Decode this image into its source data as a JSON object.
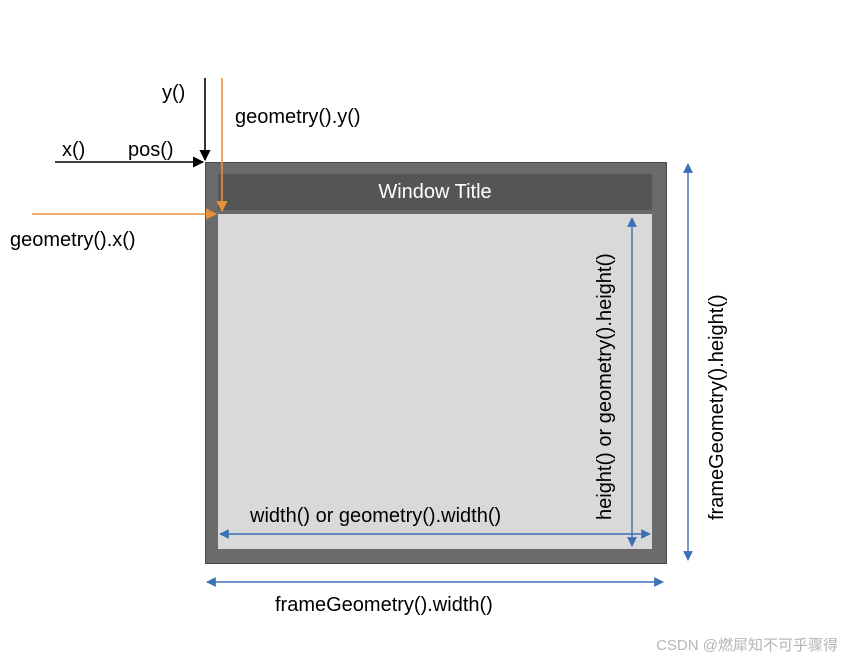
{
  "labels": {
    "y": "y()",
    "x": "x()",
    "pos": "pos()",
    "gy": "geometry().y()",
    "gx": "geometry().x()",
    "width": "width() or geometry().width()",
    "height": "height() or geometry().height()",
    "frameWidth": "frameGeometry().width()",
    "frameHeight": "frameGeometry().height()"
  },
  "window": {
    "title": "Window Title"
  },
  "watermark": "CSDN @燃犀知不可乎骤得",
  "colors": {
    "frame": "#6b6b6b",
    "titlebar": "#555555",
    "client": "#d9d9d9",
    "blackArrow": "#000000",
    "orangeArrow": "#e8913c",
    "blueArrow": "#3b6fb6"
  },
  "geometry_note": "Diagram of Qt widget geometry: x()/y()/pos() point to frame top-left; geometry().x()/y() point to client-area top-left; width()/height() measure client area; frameGeometry().width()/height() measure full frame."
}
